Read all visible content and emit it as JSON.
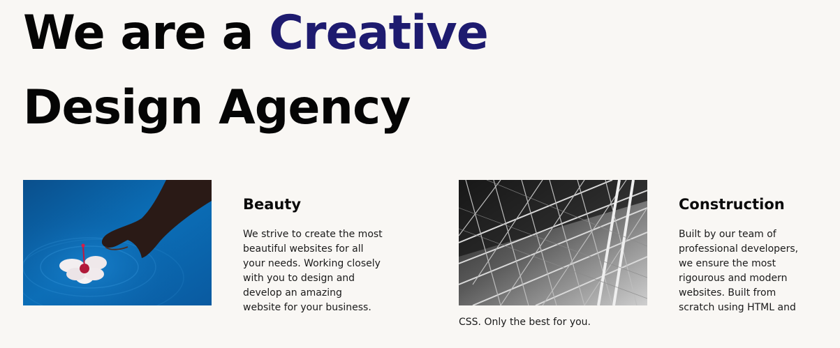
{
  "hero": {
    "title_prefix": "We are a ",
    "title_accent": "Creative",
    "title_line2": "Design Agency",
    "accent_color": "#1e1b6f"
  },
  "features": {
    "beauty": {
      "title": "Beauty",
      "body": "We strive to create the most beautiful websites for all your needs. Working closely with you to design and develop an amazing website for your business."
    },
    "construction": {
      "title": "Construction",
      "body": "Built by our team of professional developers, we ensure the most rigourous and modern websites. Built from scratch using HTML and",
      "body_continued": "CSS. Only the best for you."
    }
  }
}
